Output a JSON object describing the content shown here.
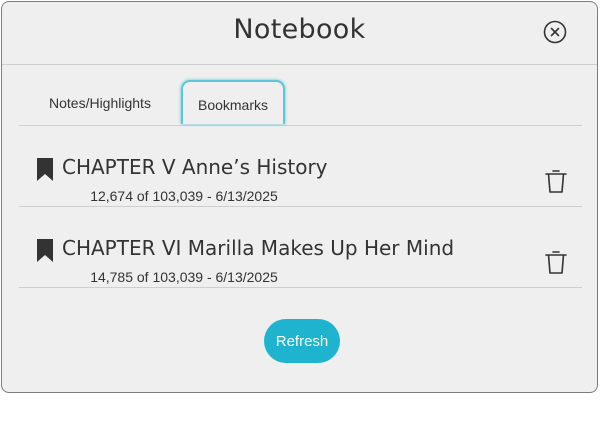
{
  "dialog": {
    "title": "Notebook"
  },
  "tabs": [
    {
      "label": "Notes/Highlights",
      "active": false
    },
    {
      "label": "Bookmarks",
      "active": true
    }
  ],
  "bookmarks": [
    {
      "title": "CHAPTER V Anne’s History",
      "meta": "12,674 of 103,039 - 6/13/2025"
    },
    {
      "title": "CHAPTER VI Marilla Makes Up Her Mind",
      "meta": "14,785 of 103,039 - 6/13/2025"
    }
  ],
  "actions": {
    "refresh_label": "Refresh"
  },
  "icons": {
    "close": "close-circle-icon",
    "bookmark": "bookmark-icon",
    "delete": "trash-icon"
  },
  "colors": {
    "accent": "#1eb4cf",
    "tab_focus": "#5cc6db",
    "dialog_bg": "#efefef",
    "text": "#333333"
  }
}
